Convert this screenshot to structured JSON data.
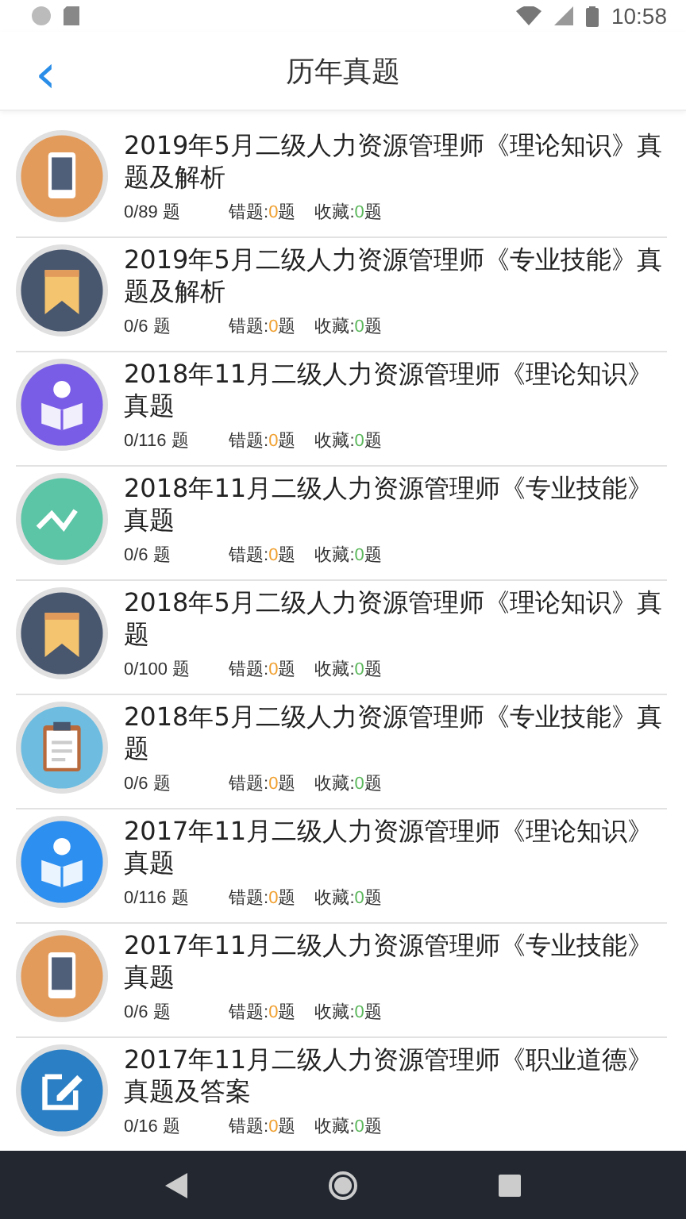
{
  "status_bar": {
    "time": "10:58"
  },
  "header": {
    "back": "‹",
    "title": "历年真题"
  },
  "papers": [
    {
      "kind": "phone",
      "title": "2019年5月二级人力资源管理师《理论知识》真题及解析",
      "progress": "0/89 题",
      "wrong": {
        "label": "错题:",
        "count": "0",
        "unit": "题"
      },
      "fav": {
        "label": "收藏:",
        "count": "0",
        "unit": "题"
      }
    },
    {
      "kind": "bookmark",
      "title": "2019年5月二级人力资源管理师《专业技能》真题及解析",
      "progress": "0/6 题",
      "wrong": {
        "label": "错题:",
        "count": "0",
        "unit": "题"
      },
      "fav": {
        "label": "收藏:",
        "count": "0",
        "unit": "题"
      }
    },
    {
      "kind": "reader",
      "title": "2018年11月二级人力资源管理师《理论知识》真题",
      "progress": "0/116 题",
      "wrong": {
        "label": "错题:",
        "count": "0",
        "unit": "题"
      },
      "fav": {
        "label": "收藏:",
        "count": "0",
        "unit": "题"
      }
    },
    {
      "kind": "chart",
      "title": "2018年11月二级人力资源管理师《专业技能》真题",
      "progress": "0/6 题",
      "wrong": {
        "label": "错题:",
        "count": "0",
        "unit": "题"
      },
      "fav": {
        "label": "收藏:",
        "count": "0",
        "unit": "题"
      }
    },
    {
      "kind": "bookmark",
      "title": "2018年5月二级人力资源管理师《理论知识》真题",
      "progress": "0/100 题",
      "wrong": {
        "label": "错题:",
        "count": "0",
        "unit": "题"
      },
      "fav": {
        "label": "收藏:",
        "count": "0",
        "unit": "题"
      }
    },
    {
      "kind": "clipboard",
      "title": "2018年5月二级人力资源管理师《专业技能》真题",
      "progress": "0/6 题",
      "wrong": {
        "label": "错题:",
        "count": "0",
        "unit": "题"
      },
      "fav": {
        "label": "收藏:",
        "count": "0",
        "unit": "题"
      }
    },
    {
      "kind": "reader_blue",
      "title": "2017年11月二级人力资源管理师《理论知识》真题",
      "progress": "0/116 题",
      "wrong": {
        "label": "错题:",
        "count": "0",
        "unit": "题"
      },
      "fav": {
        "label": "收藏:",
        "count": "0",
        "unit": "题"
      }
    },
    {
      "kind": "phone",
      "title": "2017年11月二级人力资源管理师《专业技能》真题",
      "progress": "0/6 题",
      "wrong": {
        "label": "错题:",
        "count": "0",
        "unit": "题"
      },
      "fav": {
        "label": "收藏:",
        "count": "0",
        "unit": "题"
      }
    },
    {
      "kind": "edit",
      "title": "2017年11月二级人力资源管理师《职业道德》真题及答案",
      "progress": "0/16 题",
      "wrong": {
        "label": "错题:",
        "count": "0",
        "unit": "题"
      },
      "fav": {
        "label": "收藏:",
        "count": "0",
        "unit": "题"
      }
    }
  ]
}
